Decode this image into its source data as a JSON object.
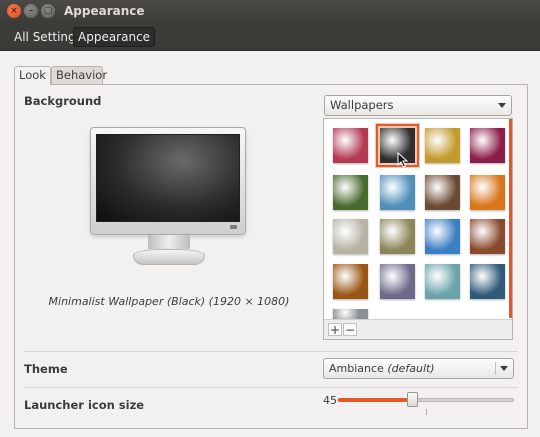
{
  "window": {
    "title": "Appearance",
    "close_glyph": "×",
    "min_glyph": "–",
    "max_glyph": "▢"
  },
  "navbar": {
    "crumbs": [
      "All Settings",
      "Appearance"
    ]
  },
  "tabs": [
    {
      "label": "Look",
      "active": true
    },
    {
      "label": "Behavior",
      "active": false
    }
  ],
  "background": {
    "label": "Background",
    "source_value": "Wallpapers",
    "caption": "Minimalist Wallpaper (Black) (1920 × 1080)",
    "thumbnails": [
      {
        "name": "pink-bokeh",
        "color": "#b33a52"
      },
      {
        "name": "minimalist-black",
        "color": "#2f2f2f",
        "selected": true
      },
      {
        "name": "yellow-flower-clock",
        "color": "#c49a2c"
      },
      {
        "name": "magenta-swirl",
        "color": "#8a1e4a"
      },
      {
        "name": "green-plant",
        "color": "#4a6b2f"
      },
      {
        "name": "blue-sky-seeds",
        "color": "#4f8fba"
      },
      {
        "name": "brown-branches",
        "color": "#6b4a34"
      },
      {
        "name": "orange-light",
        "color": "#d9751a"
      },
      {
        "name": "white-flowers",
        "color": "#b7b2a4"
      },
      {
        "name": "yellow-flower-blur",
        "color": "#8c8558"
      },
      {
        "name": "blue-cartoon",
        "color": "#3b7fc4"
      },
      {
        "name": "brown-abstract",
        "color": "#8a4a2e"
      },
      {
        "name": "orange-curve",
        "color": "#9a5512"
      },
      {
        "name": "sunset-sea",
        "color": "#6e6a8a"
      },
      {
        "name": "teal-glass",
        "color": "#6aa3a8"
      },
      {
        "name": "blue-night",
        "color": "#2f5a7a"
      },
      {
        "name": "grey-partial",
        "color": "#8a8f94"
      }
    ],
    "add_glyph": "+",
    "remove_glyph": "−"
  },
  "theme": {
    "label": "Theme",
    "value": "Ambiance",
    "value_suffix": "(default)"
  },
  "launcher": {
    "label": "Launcher icon size",
    "value": "45",
    "fraction": 0.42
  },
  "colors": {
    "accent": "#e45a2b",
    "titlebar": "#3c3b37",
    "window_bg": "#f2f1f0"
  },
  "icons": {
    "cursor": "mouse-pointer-icon"
  }
}
